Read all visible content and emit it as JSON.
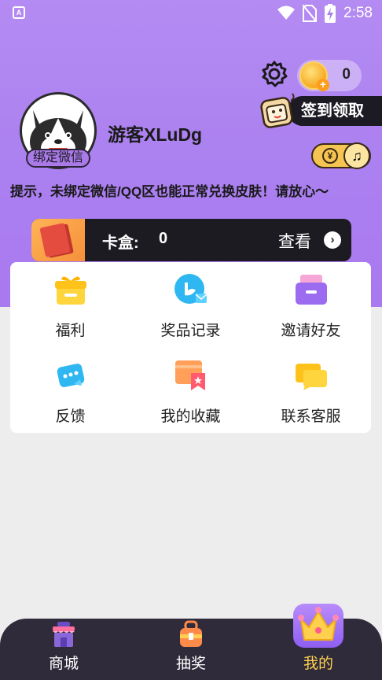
{
  "status_bar": {
    "time": "2:58",
    "app_icon_letter": "A"
  },
  "header": {
    "coin_count": "0",
    "signin_label": "签到领取",
    "username": "游客XLuDg",
    "bind_label": "绑定微信",
    "music_toggle_symbol": "¥",
    "tip": "提示，未绑定微信/QQ区也能正常兑换皮肤！请放心～"
  },
  "cardbox": {
    "label": "卡盒:",
    "count": "0",
    "view_label": "查看"
  },
  "grid": {
    "items": [
      {
        "label": "福利",
        "icon": "gift-icon"
      },
      {
        "label": "奖品记录",
        "icon": "record-chat-icon"
      },
      {
        "label": "邀请好友",
        "icon": "invite-box-icon"
      },
      {
        "label": "反馈",
        "icon": "feedback-bubble-icon"
      },
      {
        "label": "我的收藏",
        "icon": "favorites-card-icon"
      },
      {
        "label": "联系客服",
        "icon": "customer-service-icon"
      }
    ]
  },
  "bottom_nav": {
    "items": [
      {
        "label": "商城",
        "icon": "shop-icon"
      },
      {
        "label": "抽奖",
        "icon": "lottery-bag-icon"
      },
      {
        "label": "我的",
        "icon": "crown-icon",
        "active": true
      }
    ]
  },
  "colors": {
    "hero_purple": "#ab80f0",
    "dark_bar": "#1d1b22",
    "nav_bg": "#302b3b",
    "active_nav": "#ffd04d"
  }
}
